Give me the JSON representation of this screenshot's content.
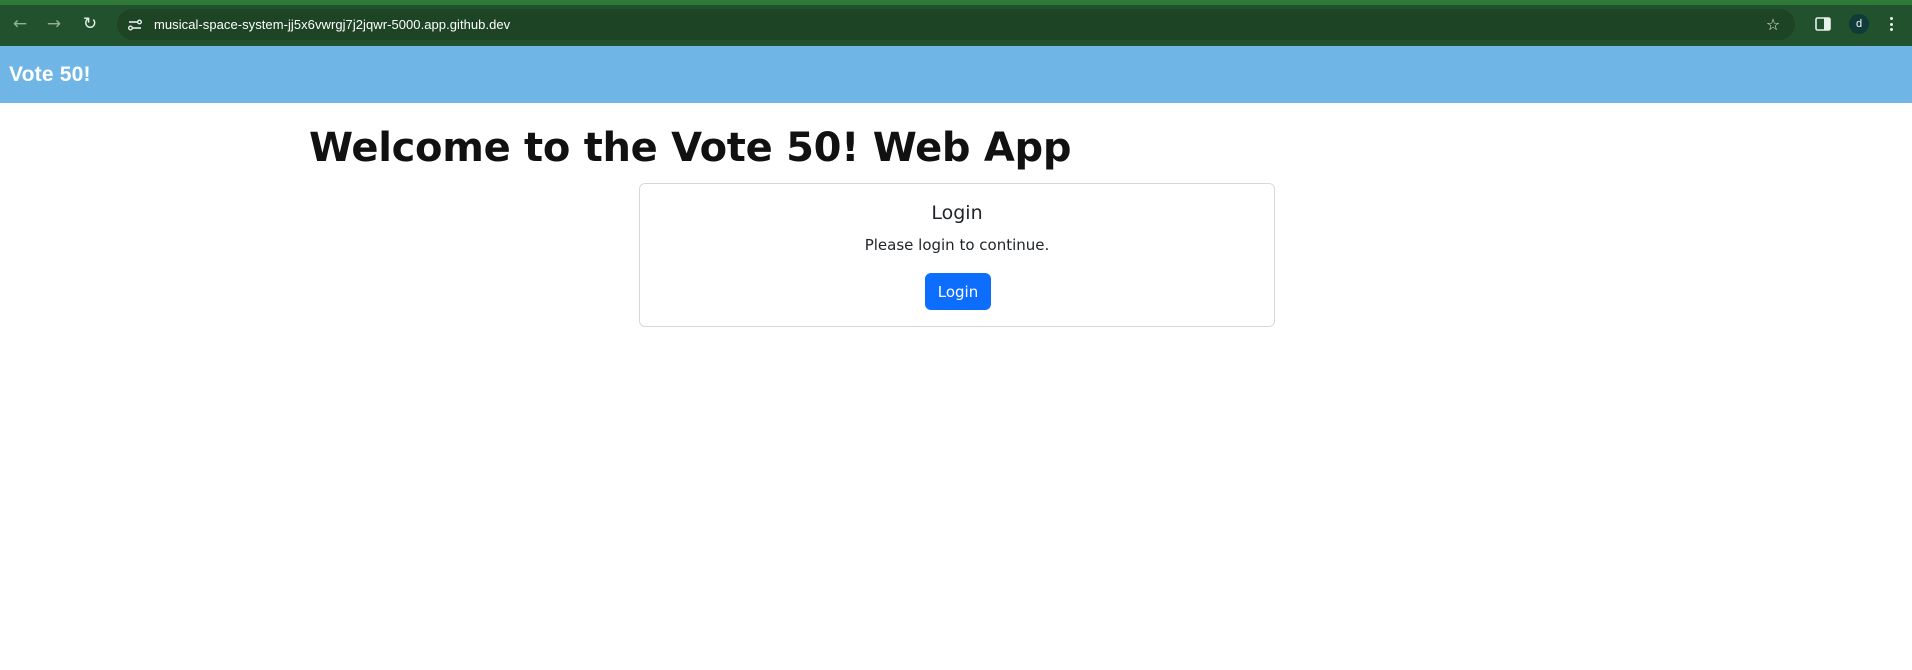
{
  "browser": {
    "url": "musical-space-system-jj5x6vwrgj7j2jqwr-5000.app.github.dev",
    "back_icon": "arrow-left-icon",
    "forward_icon": "arrow-right-icon",
    "reload_icon": "reload-icon",
    "bookmark_icon": "star-icon",
    "profile_initial": "d",
    "colors": {
      "chrome_bg": "#22522d",
      "omnibox_bg": "#1d4424",
      "avatar_bg": "#0f3b39"
    }
  },
  "navbar": {
    "brand": "Vote 50!",
    "color": "#6fb6e6"
  },
  "main": {
    "title": "Welcome to the Vote 50! Web App",
    "login_card": {
      "title": "Login",
      "text": "Please login to continue.",
      "button_label": "Login",
      "button_color": "#0d6efd"
    }
  }
}
